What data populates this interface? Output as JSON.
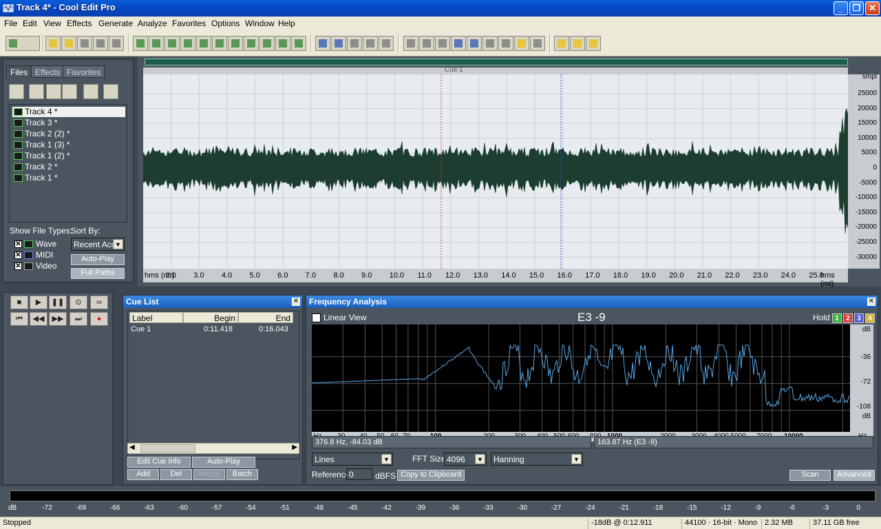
{
  "window": {
    "title": "Track 4* - Cool Edit Pro"
  },
  "menu": [
    "File",
    "Edit",
    "View",
    "Effects",
    "Generate",
    "Analyze",
    "Favorites",
    "Options",
    "Window",
    "Help"
  ],
  "organizer": {
    "tabs": [
      "Files",
      "Effects",
      "Favorites"
    ],
    "files": [
      "Track 4 *",
      "Track 3 *",
      "Track 2 (2) *",
      "Track 1 (3) *",
      "Track 1 (2) *",
      "Track 2 *",
      "Track 1 *"
    ],
    "show_file_types_label": "Show File Types:",
    "file_types": [
      "Wave",
      "MIDI",
      "Video"
    ],
    "sort_by_label": "Sort By:",
    "sort_value": "Recent Acc",
    "auto_play": "Auto-Play",
    "full_paths": "Full Paths"
  },
  "waveform": {
    "cue_label": "Cue 1",
    "unit_left": "hms (mt)",
    "unit_right": "hms (mt)",
    "time_ticks": [
      "2.0",
      "3.0",
      "4.0",
      "5.0",
      "6.0",
      "7.0",
      "8.0",
      "9.0",
      "10.0",
      "11.0",
      "12.0",
      "13.0",
      "14.0",
      "15.0",
      "16.0",
      "17.0",
      "18.0",
      "19.0",
      "20.0",
      "21.0",
      "22.0",
      "23.0",
      "24.0",
      "25.0"
    ],
    "amp_unit": "smpl",
    "amp_ticks": [
      "25000",
      "20000",
      "15000",
      "10000",
      "5000",
      "0",
      "-5000",
      "-10000",
      "-15000",
      "-20000",
      "-25000",
      "-30000"
    ],
    "wave_color": "#1c3d2f",
    "bg_color": "#e8ecf0"
  },
  "cue_list": {
    "title": "Cue List",
    "columns": [
      "Label",
      "Begin",
      "End"
    ],
    "rows": [
      {
        "label": "Cue 1",
        "begin": "0:11.418",
        "end": "0:16.043"
      }
    ],
    "buttons": {
      "edit_cue_info": "Edit Cue Info",
      "auto_play": "Auto-Play",
      "add": "Add",
      "del": "Del",
      "merge": "Merge",
      "batch": "Batch"
    }
  },
  "frequency": {
    "title": "Frequency Analysis",
    "linear_view": "Linear View",
    "note": "E3 -9",
    "hold_label": "Hold",
    "hold": [
      "1",
      "2",
      "3",
      "4"
    ],
    "hold_colors": [
      "#3cb43c",
      "#d83c3c",
      "#5a5ad8",
      "#d8b43c"
    ],
    "y_ticks": [
      "dB",
      "-36",
      "-72",
      "-108",
      "dB"
    ],
    "x_ticks": [
      "Hz",
      "30",
      "40",
      "50",
      "60",
      "70",
      "100",
      "200",
      "300",
      "400",
      "500",
      "600",
      "800",
      "1000",
      "2000",
      "3000",
      "4000",
      "5000",
      "7000",
      "10000",
      "Hz"
    ],
    "readout_left": "376.8 Hz, -84.03 dB",
    "readout_right": "163.87 Hz (E3 -9)",
    "plot_type": "Lines",
    "fft_label": "FFT Size",
    "fft_size": "4096",
    "window": "Hanning",
    "reference_label": "Reference",
    "reference": "0",
    "dbfs": "dBFS",
    "copy": "Copy to Clipboard",
    "scan": "Scan",
    "advanced": "Advanced",
    "line_color": "#5aa8e8"
  },
  "level_meter": {
    "ticks": [
      "dB",
      "-72",
      "-69",
      "-66",
      "-63",
      "-60",
      "-57",
      "-54",
      "-51",
      "-48",
      "-45",
      "-42",
      "-39",
      "-36",
      "-33",
      "-30",
      "-27",
      "-24",
      "-21",
      "-18",
      "-15",
      "-12",
      "-9",
      "-6",
      "-3",
      "0"
    ]
  },
  "status": {
    "state": "Stopped",
    "level": "-18dB @  0:12.911",
    "format": "44100 · 16-bit · Mono",
    "size": "2.32 MB",
    "free": "37.11 GB free"
  }
}
